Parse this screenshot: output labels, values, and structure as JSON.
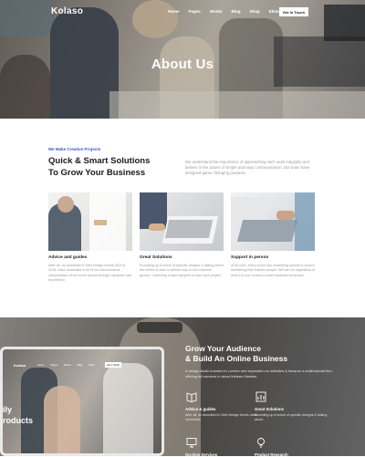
{
  "nav": {
    "logo": "Kolaso",
    "menu": [
      "Home",
      "Pages",
      "Works",
      "Blog",
      "Shop",
      "Elements"
    ],
    "cta": "Get In Touch"
  },
  "hero": {
    "title": "About Us"
  },
  "intro": {
    "kicker": "We Make Creative Projects",
    "headline_line1": "Quick & Smart Solutions",
    "headline_line2": "To Grow Your Business",
    "text": "We understand the importance of approaching each work integrally and believe in the power of simple and easy communication. Our team have designed game changing products."
  },
  "features": [
    {
      "title": "Advice and guides",
      "text": "After all, as described in Web Design trends 2015 & 2016, class dominates a lot of our subconscious interpretation of the world around thought complete user experience."
    },
    {
      "title": "Great Solutions",
      "text": "Rounding up a bunch of specific designs & talking about the merits of each is perfect way to find common ground. Collecting a wide samples to start your project."
    },
    {
      "title": "Support in person",
      "text": "At its core, every brand has something special to secure something that inspires people. We can do regardless of what it is you unwind a small business showcase."
    }
  ],
  "bottom": {
    "title_line1": "Grow Your Audience",
    "title_line2": "& Build An Online Business",
    "text": "A design studio founded in London and expanded our activities & became a multinational firm, offering full services in about thirteen Markets.",
    "services": [
      {
        "icon": "book-icon",
        "title": "Advice & guides",
        "text": "After all, as described in Web Design trends class dominates."
      },
      {
        "icon": "chart-icon",
        "title": "Great Solutions",
        "text": "Rounding up a bunch of specific designs & talking about."
      },
      {
        "icon": "monitor-icon",
        "title": "On-time Services",
        "text": ""
      },
      {
        "icon": "bulb-icon",
        "title": "Product Research",
        "text": ""
      }
    ]
  },
  "laptop": {
    "logo": "Kolaso",
    "menu": [
      "Home",
      "Pages",
      "Works",
      "Blog",
      "Shop"
    ],
    "cta": "Get In Touch",
    "text_line1": "ily",
    "text_line2": "roducts"
  },
  "colors": {
    "accent": "#3b52c4",
    "white": "#ffffff"
  }
}
